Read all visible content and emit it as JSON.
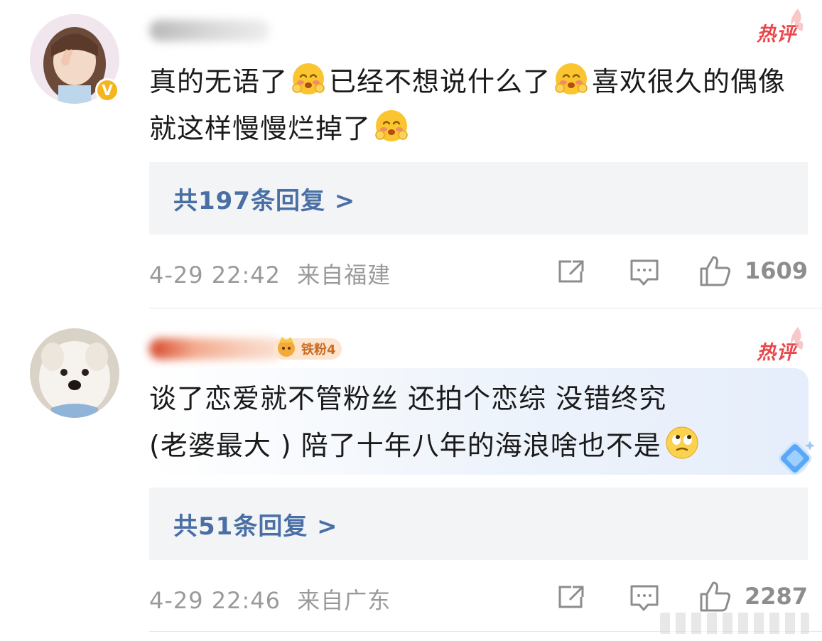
{
  "comments": [
    {
      "hot_label": "热评",
      "content_parts": [
        "真的无语了",
        "已经不想说什么了",
        "喜欢很久的偶像就这样慢慢烂掉了"
      ],
      "emoji": "blushing-emoji",
      "replies_label": "共197条回复 >",
      "timestamp": "4-29 22:42",
      "location": "来自福建",
      "like_count": "1609",
      "verified_badge": "V"
    },
    {
      "hot_label": "热评",
      "fan_badge": "铁粉4",
      "content_line1": "谈了恋爱就不管粉丝 还拍个恋综 没错终究",
      "content_line2": "(老婆最大 ) 陪了十年八年的海浪啥也不是",
      "emoji": "eye-roll-emoji",
      "replies_label": "共51条回复 >",
      "timestamp": "4-29 22:46",
      "location": "来自广东",
      "like_count": "2287"
    }
  ],
  "colors": {
    "hot": "#e8474b",
    "reply_link": "#4a6fa5",
    "meta": "#9a9a9a",
    "reply_bg": "#f3f4f6",
    "verified": "#f6b51e"
  }
}
